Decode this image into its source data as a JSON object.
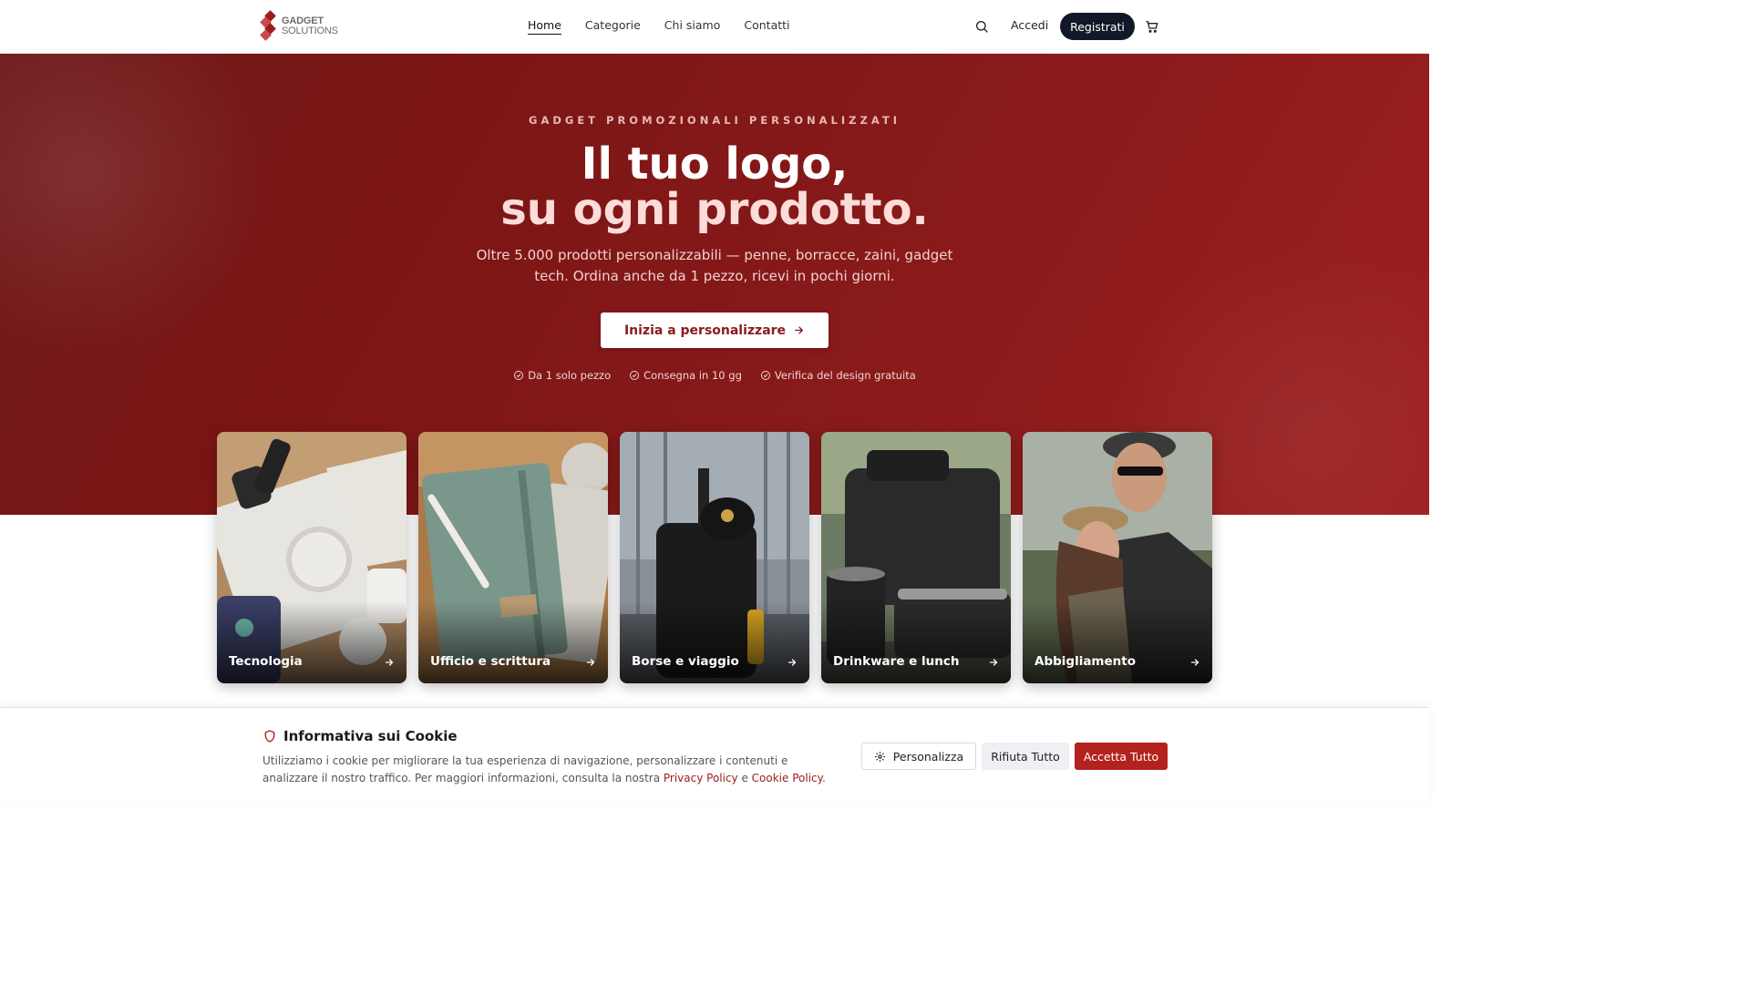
{
  "brand": {
    "name_line1": "GADGET",
    "name_line2": "SOLUTIONS",
    "accent": "#9b1c1c",
    "dark": "#111827"
  },
  "nav": {
    "links": [
      "Home",
      "Categorie",
      "Chi siamo",
      "Contatti"
    ],
    "active": "Home",
    "search_icon": "search-icon",
    "login_label": "Accedi",
    "register_label": "Registrati",
    "cart_icon": "cart-icon"
  },
  "hero": {
    "eyebrow": "GADGET PROMOZIONALI PERSONALIZZATI",
    "headline_line1": "Il tuo logo,",
    "headline_line2": "su ogni prodotto.",
    "subtitle": "Oltre 5.000 prodotti personalizzabili — penne, borracce, zaini, gadget tech. Ordina anche da 1 pezzo, ricevi in pochi giorni.",
    "cta_label": "Inizia a personalizzare",
    "trust": [
      "Da 1 solo pezzo",
      "Consegna in 10 gg",
      "Verifica del design gratuita"
    ]
  },
  "categories": [
    {
      "label": "Tecnologia"
    },
    {
      "label": "Ufficio e scrittura"
    },
    {
      "label": "Borse e viaggio"
    },
    {
      "label": "Drinkware e lunch"
    },
    {
      "label": "Abbigliamento"
    }
  ],
  "cookie": {
    "title": "Informativa sui Cookie",
    "text_before": "Utilizziamo i cookie per migliorare la tua esperienza di navigazione, personalizzare i contenuti e analizzare il nostro traffico. Per maggiori informazioni, consulta la nostra ",
    "privacy_link": "Privacy Policy",
    "text_between": " e ",
    "cookie_link": "Cookie Policy",
    "text_after": ".",
    "customize_label": "Personalizza",
    "reject_label": "Rifiuta Tutto",
    "accept_label": "Accetta Tutto"
  }
}
